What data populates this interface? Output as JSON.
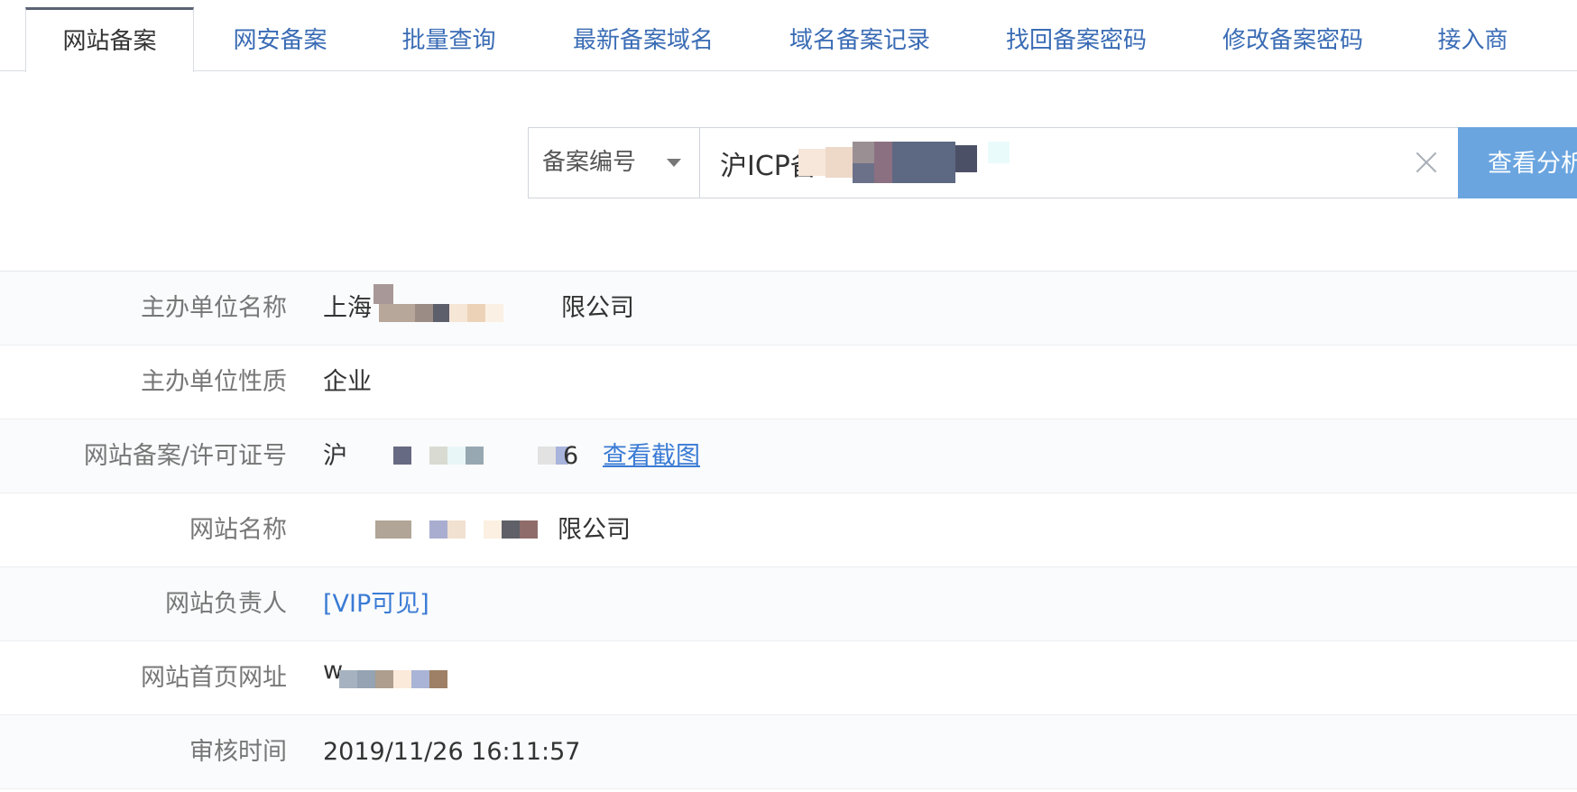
{
  "tabs": [
    {
      "label": "网站备案",
      "active": true
    },
    {
      "label": "网安备案",
      "active": false
    },
    {
      "label": "批量查询",
      "active": false
    },
    {
      "label": "最新备案域名",
      "active": false
    },
    {
      "label": "域名备案记录",
      "active": false
    },
    {
      "label": "找回备案密码",
      "active": false
    },
    {
      "label": "修改备案密码",
      "active": false
    },
    {
      "label": "接入商",
      "active": false
    }
  ],
  "search": {
    "type_label": "备案编号",
    "value": "沪ICP备",
    "button_label": "查看分析"
  },
  "details": {
    "rows": [
      {
        "label": "主办单位名称",
        "value_prefix": "上海",
        "value_suffix": "限公司"
      },
      {
        "label": "主办单位性质",
        "value": "企业"
      },
      {
        "label": "网站备案/许可证号",
        "value_prefix": "沪",
        "value_suffix": "6",
        "link": "查看截图"
      },
      {
        "label": "网站名称",
        "value_suffix": "限公司"
      },
      {
        "label": "网站负责人",
        "value": "[VIP可见]"
      },
      {
        "label": "网站首页网址",
        "value_prefix": "w"
      },
      {
        "label": "审核时间",
        "value": "2019/11/26 16:11:57"
      }
    ]
  },
  "colors": {
    "accent": "#3a7bd5",
    "button": "#6aa5e0",
    "active_tab_border": "#5b6473"
  },
  "icons": {
    "type_caret": "caret-down-icon",
    "clear": "close-icon"
  }
}
